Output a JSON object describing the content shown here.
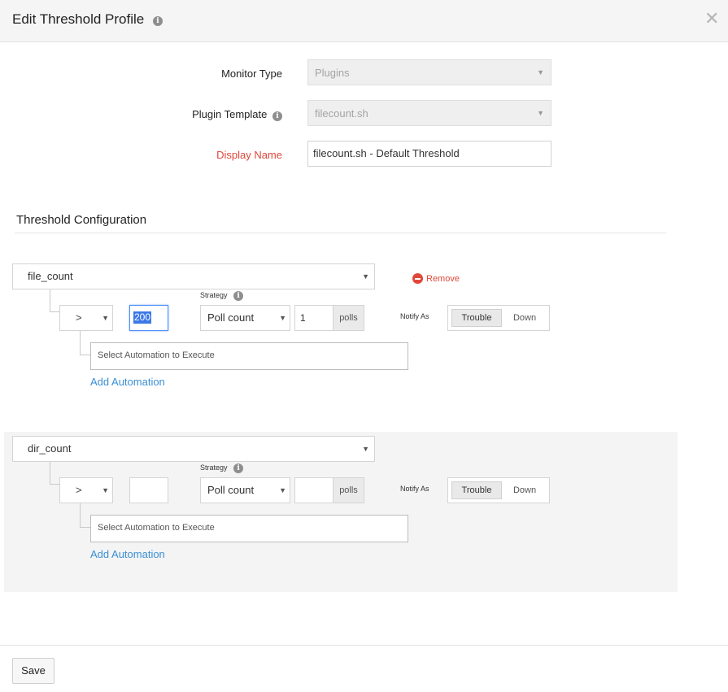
{
  "dialog": {
    "title": "Edit Threshold Profile",
    "info_icon": "info-icon",
    "close_icon": "close-icon"
  },
  "form": {
    "monitor_type": {
      "label": "Monitor Type",
      "value": "Plugins"
    },
    "plugin_template": {
      "label": "Plugin Template",
      "value": "filecount.sh"
    },
    "display_name": {
      "label": "Display Name",
      "value": "filecount.sh - Default Threshold"
    }
  },
  "threshold_configuration": {
    "title": "Threshold Configuration",
    "remove_label": "Remove",
    "rows": [
      {
        "metric": "file_count",
        "operator": ">",
        "value": "200",
        "strategy_label": "Strategy",
        "strategy": "Poll count",
        "polls_value": "1",
        "polls_addon": "polls",
        "notify_label": "Notify As",
        "notify_options": [
          "Trouble",
          "Down"
        ],
        "notify_selected": "Trouble",
        "automation_placeholder": "Select Automation to Execute",
        "add_automation": "Add Automation"
      },
      {
        "metric": "dir_count",
        "operator": ">",
        "value": "",
        "strategy_label": "Strategy",
        "strategy": "Poll count",
        "polls_value": "",
        "polls_addon": "polls",
        "notify_label": "Notify As",
        "notify_options": [
          "Trouble",
          "Down"
        ],
        "notify_selected": "Trouble",
        "automation_placeholder": "Select Automation to Execute",
        "add_automation": "Add Automation"
      }
    ]
  },
  "footer": {
    "save_label": "Save"
  }
}
